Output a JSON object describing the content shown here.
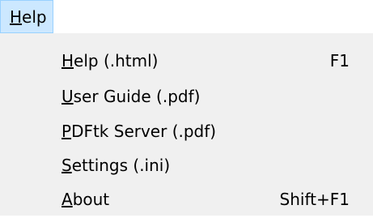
{
  "menubar": {
    "title_accel": "H",
    "title_rest": "elp"
  },
  "menu": {
    "items": [
      {
        "accel": "H",
        "rest": "elp (.html)",
        "shortcut": "F1"
      },
      {
        "accel": "U",
        "rest": "ser Guide (.pdf)",
        "shortcut": ""
      },
      {
        "accel": "P",
        "rest": "DFtk Server (.pdf)",
        "shortcut": ""
      },
      {
        "accel": "S",
        "rest": "ettings (.ini)",
        "shortcut": ""
      },
      {
        "accel": "A",
        "rest": "bout",
        "shortcut": "Shift+F1"
      }
    ]
  },
  "colors": {
    "menubar_highlight": "#cce8ff",
    "menubar_highlight_border": "#99d1ff",
    "dropdown_background": "#f0f0f0"
  }
}
